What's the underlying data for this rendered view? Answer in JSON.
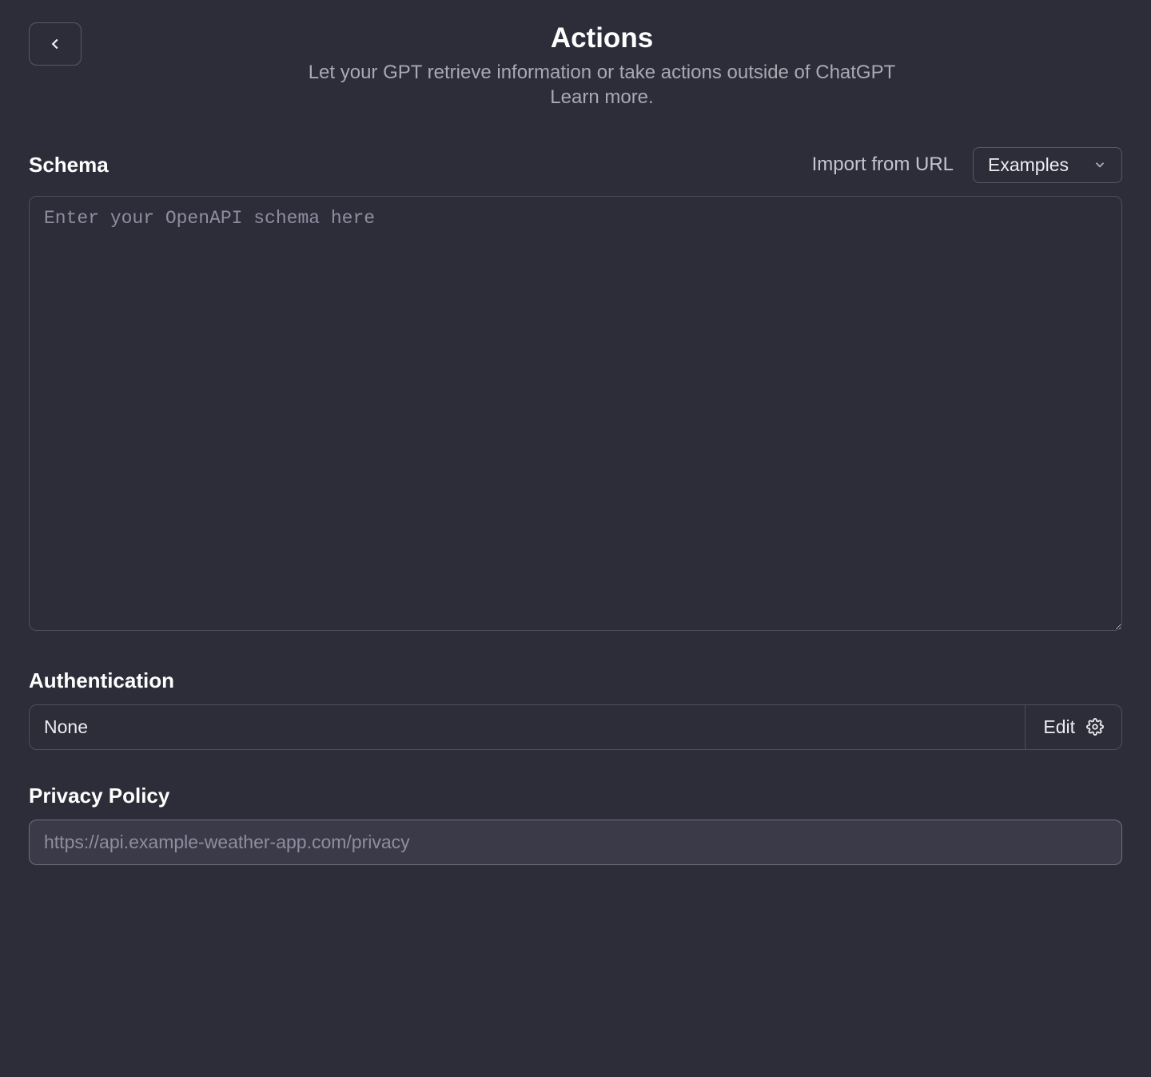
{
  "header": {
    "title": "Actions",
    "subtitle": "Let your GPT retrieve information or take actions outside of ChatGPT",
    "learn_more": "Learn more."
  },
  "schema": {
    "label": "Schema",
    "import_link": "Import from URL",
    "examples_label": "Examples",
    "placeholder": "Enter your OpenAPI schema here",
    "value": ""
  },
  "authentication": {
    "label": "Authentication",
    "value": "None",
    "edit_label": "Edit"
  },
  "privacy": {
    "label": "Privacy Policy",
    "placeholder": "https://api.example-weather-app.com/privacy",
    "value": ""
  }
}
